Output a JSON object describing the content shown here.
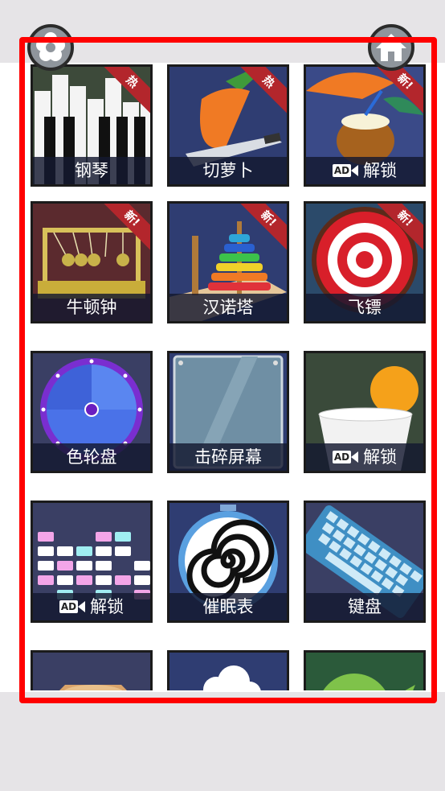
{
  "header": {
    "left_icon": "flower-settings-icon",
    "right_icon": "home-icon"
  },
  "grid": {
    "tiles": [
      {
        "label": "钢琴",
        "badge": "热",
        "locked": false,
        "icon": "piano-keys-icon"
      },
      {
        "label": "切萝卜",
        "badge": "热",
        "locked": false,
        "icon": "carrot-knife-icon"
      },
      {
        "label": "解锁",
        "badge": "新!",
        "locked": true,
        "icon": "coconut-drink-icon"
      },
      {
        "label": "牛顿钟",
        "badge": "新!",
        "locked": false,
        "icon": "newtons-cradle-icon"
      },
      {
        "label": "汉诺塔",
        "badge": "新!",
        "locked": false,
        "icon": "hanoi-tower-icon"
      },
      {
        "label": "飞镖",
        "badge": "新!",
        "locked": false,
        "icon": "dartboard-icon"
      },
      {
        "label": "色轮盘",
        "badge": "",
        "locked": false,
        "icon": "color-wheel-icon"
      },
      {
        "label": "击碎屏幕",
        "badge": "",
        "locked": false,
        "icon": "glass-screen-icon"
      },
      {
        "label": "解锁",
        "badge": "",
        "locked": true,
        "icon": "pong-cup-icon"
      },
      {
        "label": "解锁",
        "badge": "",
        "locked": true,
        "icon": "equalizer-icon"
      },
      {
        "label": "催眠表",
        "badge": "",
        "locked": false,
        "icon": "hypnosis-spiral-icon"
      },
      {
        "label": "键盘",
        "badge": "",
        "locked": false,
        "icon": "keyboard-icon"
      },
      {
        "label": "",
        "badge": "",
        "locked": false,
        "icon": "wood-block-icon"
      },
      {
        "label": "",
        "badge": "",
        "locked": false,
        "icon": "cloud-icon"
      },
      {
        "label": "",
        "badge": "",
        "locked": false,
        "icon": "green-blob-icon"
      }
    ],
    "ad_text": "AD"
  },
  "colors": {
    "frame": "#ff0000",
    "ribbon": "#b3262c",
    "label_bg": "#141830"
  }
}
